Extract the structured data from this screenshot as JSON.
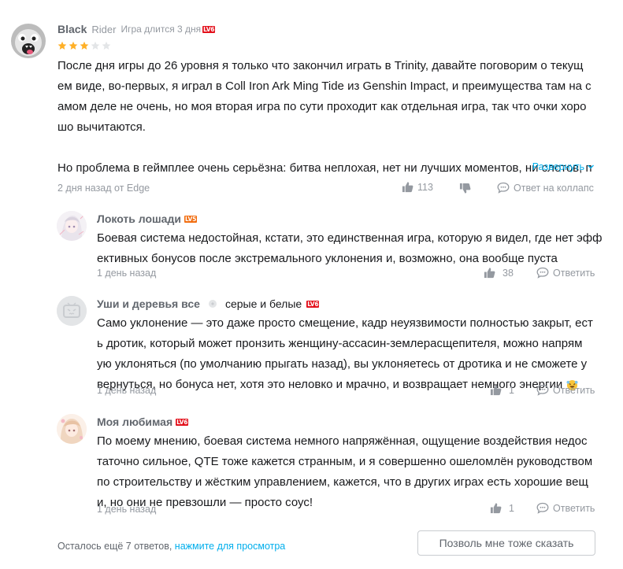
{
  "main_comment": {
    "username": "Black",
    "nickname_suffix": "Rider",
    "play_time": "Игра длится 3 дня",
    "level_badge": "LV6",
    "rating": 3,
    "rating_max": 5,
    "text_lines": [
      "После дня игры до 26 уровня я только что закончил играть в Trinity, давайте поговорим о текущ",
      "ем виде, во-первых, я играл в Coll Iron Ark Ming Tide из Genshin Impact, и преимущества там на с",
      "амом деле не очень, но моя вторая игра по сути проходит как отдельная игра, так что очки хоро",
      "шо вычитаются.",
      "",
      "Но проблема в геймплее очень серьёзна: битва неплохая, нет ни лучших моментов, ни слотов, п"
    ],
    "expand_label": "Развернуть",
    "timestamp": "2 дня назад от Edge",
    "likes": "113",
    "reply_label": "Ответ на коллапс"
  },
  "replies": [
    {
      "username": "Локоть лошади",
      "level_badge": "LV5",
      "badge_color": "orange",
      "extra": "",
      "text_lines": [
        "Боевая система недостойная, кстати, это единственная игра, которую я видел, где нет эфф",
        "ективных бонусов после экстремального уклонения и, возможно, она вообще пуста"
      ],
      "timestamp": "1 день назад",
      "likes": "38",
      "reply_label": "Ответить"
    },
    {
      "username": "Уши и деревья все",
      "level_badge": "LV6",
      "badge_color": "red",
      "extra": "серые и белые",
      "text_lines": [
        "Само уклонение — это даже просто смещение, кадр неуязвимости полностью закрыт, ест",
        "ь дротик, который может пронзить женщину-ассасин-землерасщепителя, можно напрям",
        "ую уклоняться (по умолчанию прыгать назад), вы уклоняетесь от дротика и не сможете у",
        "вернуться, но бонуса нет, хотя это неловко и мрачно, и возвращает немного энергии"
      ],
      "timestamp": "1 день назад",
      "likes": "1",
      "reply_label": "Ответить"
    },
    {
      "username": "Моя любимая",
      "level_badge": "LV6",
      "badge_color": "red",
      "extra": "",
      "text_lines": [
        "По моему мнению, боевая система немного напряжённая, ощущение воздействия недос",
        "таточно сильное, QTE тоже кажется странным, и я совершенно ошеломлён руководством",
        "по строительству и жёстким управлением, кажется, что в других играх есть хорошие вещ",
        "и, но они не превзошли — просто соус!"
      ],
      "timestamp": "1 день назад",
      "likes": "1",
      "reply_label": "Ответить"
    }
  ],
  "footer": {
    "remaining_text": "Осталось ещё 7 ответов,",
    "view_link": "нажмите для просмотра",
    "agree_button": "Позволь мне тоже сказать"
  },
  "colors": {
    "accent": "#00aeec",
    "star": "#ffb027",
    "star_empty": "#e3e5e7",
    "muted": "#9499a0"
  }
}
